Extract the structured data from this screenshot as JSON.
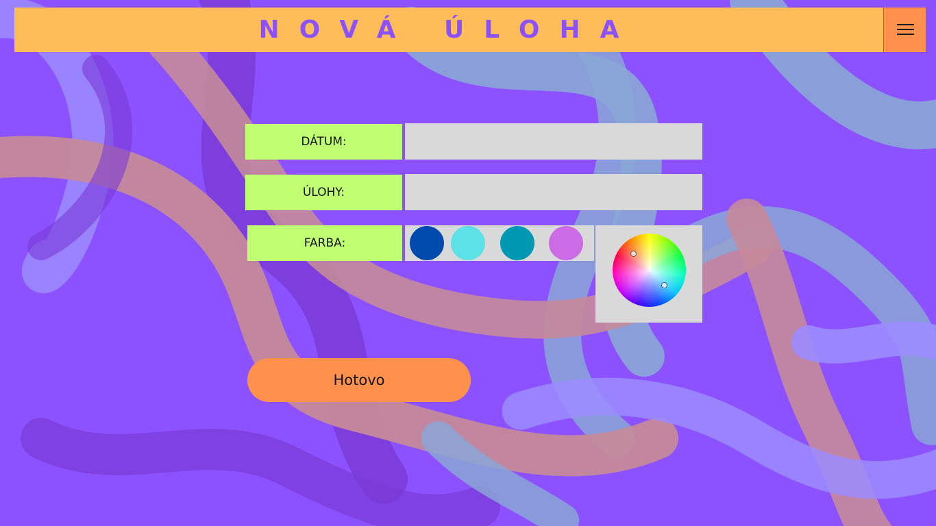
{
  "header": {
    "title": "NOVÁ ÚLOHA",
    "menu_icon": "hamburger-menu-icon"
  },
  "form": {
    "date_label": "DÁTUM:",
    "date_value": "",
    "tasks_label": "ÚLOHY:",
    "tasks_value": "",
    "color_label": "FARBA:",
    "swatches": [
      "#004aad",
      "#5ce1e6",
      "#0097b2",
      "#cb6ce6"
    ],
    "color_picker_icon": "color-wheel-icon"
  },
  "done_button": "Hotovo",
  "colors": {
    "background": "#8c52ff",
    "header": "#ffbd59",
    "menu_button": "#ff914d",
    "title": "#8c52ff",
    "label_background": "#c1ff72",
    "input_background": "#d9d9d9",
    "button": "#ff914d"
  }
}
